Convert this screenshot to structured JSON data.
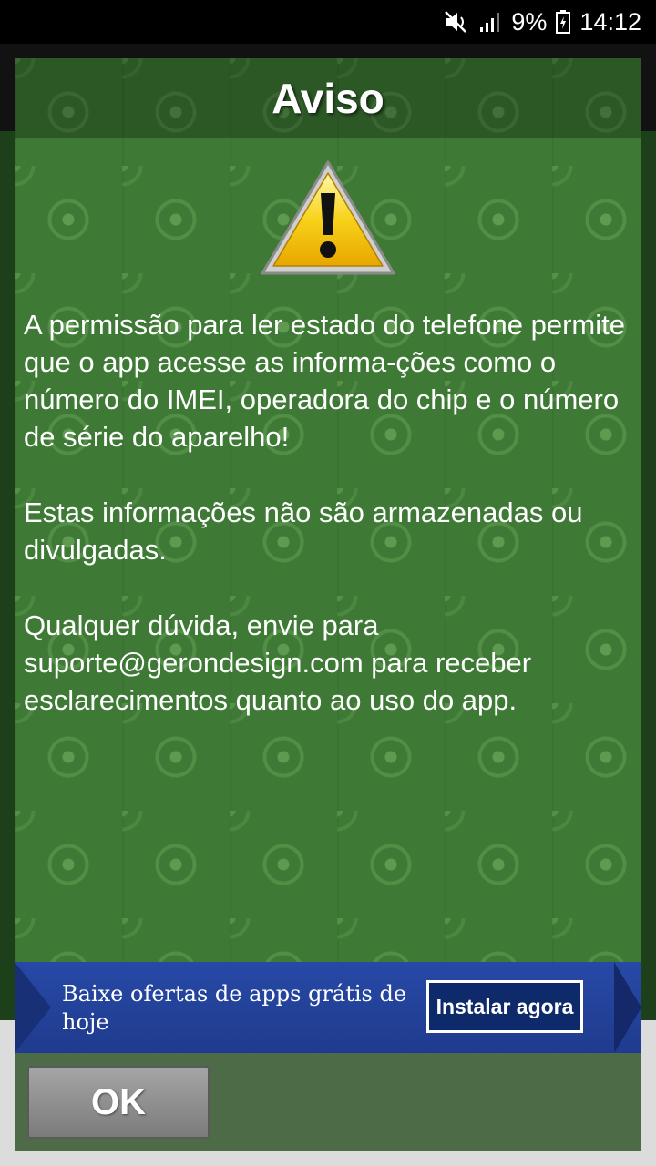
{
  "status_bar": {
    "battery": "9%",
    "time": "14:12",
    "icons": [
      "mute-icon",
      "signal-icon",
      "battery-icon"
    ]
  },
  "dialog": {
    "title": "Aviso",
    "icon": "warning-icon",
    "paragraphs": [
      "A permissão para ler estado do telefone permite que o app acesse as informa-ções como o número do IMEI, operadora do chip e o número de série do aparelho!",
      "Estas informações não são armazenadas ou divulgadas.",
      "Qualquer dúvida, envie para suporte@gerondesign.com para receber esclarecimentos quanto ao uso do app."
    ],
    "ok_label": "OK"
  },
  "ad": {
    "text": "Baixe ofertas de apps grátis de hoje",
    "button_label": "Instalar agora"
  }
}
